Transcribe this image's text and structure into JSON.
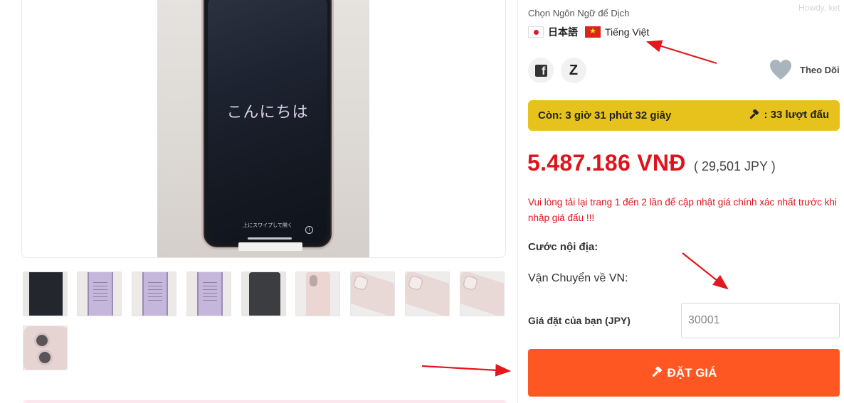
{
  "gallery": {
    "main_image": {
      "screen_greeting": "こんにちは",
      "unlock_hint": "上にスワイプして開く"
    },
    "thumbnails": [
      {
        "style": "dark"
      },
      {
        "style": "lavender"
      },
      {
        "style": "lavender"
      },
      {
        "style": "lavender"
      },
      {
        "style": "grey"
      },
      {
        "style": "pink"
      },
      {
        "style": "angle"
      },
      {
        "style": "angle"
      },
      {
        "style": "angle"
      },
      {
        "style": "camera"
      }
    ]
  },
  "language": {
    "title": "Chọn Ngôn Ngữ để Dịch",
    "options": [
      {
        "label": "日本語",
        "flag": "japan-flag-icon"
      },
      {
        "label": "Tiếng Việt",
        "flag": "vietnam-flag-icon"
      }
    ]
  },
  "watermark": "Howdy, ket",
  "share": {
    "facebook_icon": "facebook-icon",
    "zalo_label": "Z"
  },
  "follow": {
    "label": "Theo Dõi",
    "icon": "heart-icon"
  },
  "auction": {
    "time_left": "Còn: 3 giờ 31 phút 32 giây",
    "bid_count": ": 33 lượt đấu",
    "price_vnd": "5.487.186 VNĐ",
    "price_jpy": "( 29,501 JPY )",
    "notice": "Vui lòng tải lại trang 1 đến 2 lần để cập nhật giá chính xác nhất trước khi nhập giá đấu !!!",
    "domestic_shipping_label": "Cước nội địa:",
    "shipping_vn_label": "Vận Chuyển về VN:",
    "your_bid_label": "Giá đặt của bạn (JPY)",
    "your_bid_placeholder": "30001",
    "submit_label": "ĐẶT GIÁ"
  },
  "colors": {
    "timer_bar": "#e8c21c",
    "price": "#e0131c",
    "submit_button": "#fe5722",
    "annotation_arrow": "#e3171c"
  }
}
